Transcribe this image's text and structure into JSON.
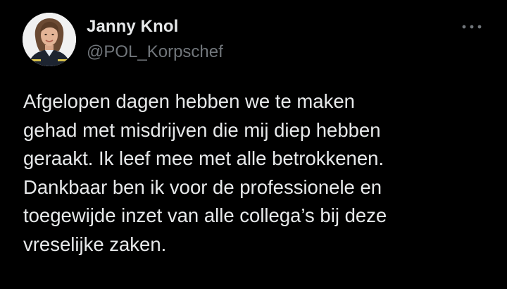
{
  "author": {
    "name": "Janny Knol",
    "handle": "@POL_Korpschef",
    "avatar_icon": "profile-photo"
  },
  "actions": {
    "more_icon": "more-horizontal-icon"
  },
  "tweet": {
    "text": "Afgelopen dagen hebben we te maken\ngehad met misdrijven die mij diep hebben\ngeraakt. Ik leef mee met alle betrokkenen.\nDankbaar ben ik voor de professionele en\ntoegewijde inzet van alle collega’s bij deze\nvreselijke zaken."
  },
  "colors": {
    "background": "#000000",
    "text_primary": "#e7e9ea",
    "text_secondary": "#71767b"
  }
}
